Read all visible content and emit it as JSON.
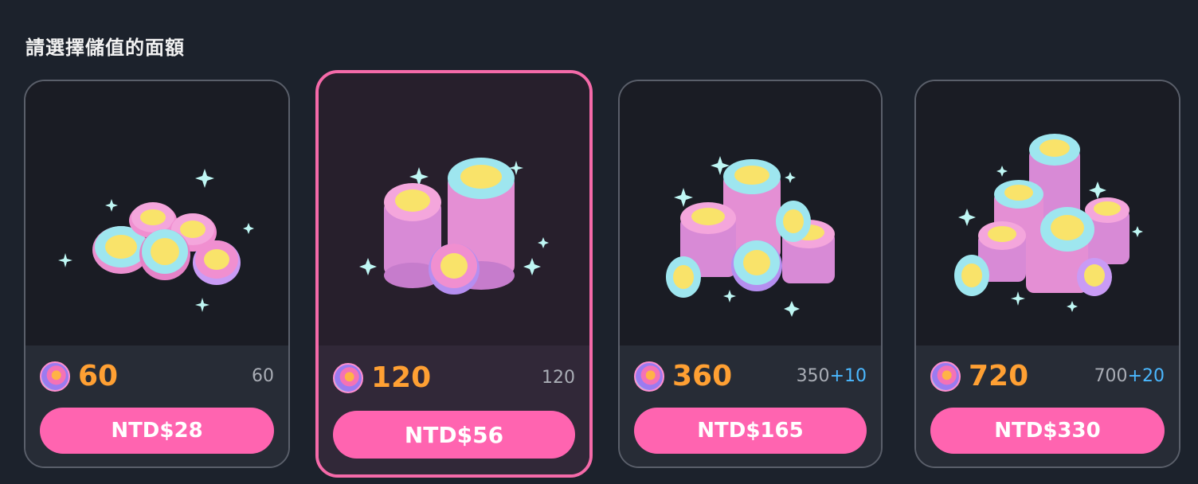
{
  "title": "請選擇儲值的面額",
  "packages": [
    {
      "coins": "60",
      "base": "60",
      "bonus": "",
      "price": "NTD$28",
      "selected": false,
      "icon": "coin-pile-small-icon"
    },
    {
      "coins": "120",
      "base": "120",
      "bonus": "",
      "price": "NTD$56",
      "selected": true,
      "icon": "coin-stacks-medium-icon"
    },
    {
      "coins": "360",
      "base": "350",
      "bonus": "+10",
      "price": "NTD$165",
      "selected": false,
      "icon": "coin-stacks-large-icon"
    },
    {
      "coins": "720",
      "base": "700",
      "bonus": "+20",
      "price": "NTD$330",
      "selected": false,
      "icon": "coin-stacks-huge-icon"
    }
  ],
  "colors": {
    "background": "#1c222c",
    "accent_pink": "#ff64b0",
    "coin_amount": "#ffa033",
    "bonus_blue": "#4bb8ff",
    "selected_border": "#f56aa9"
  }
}
